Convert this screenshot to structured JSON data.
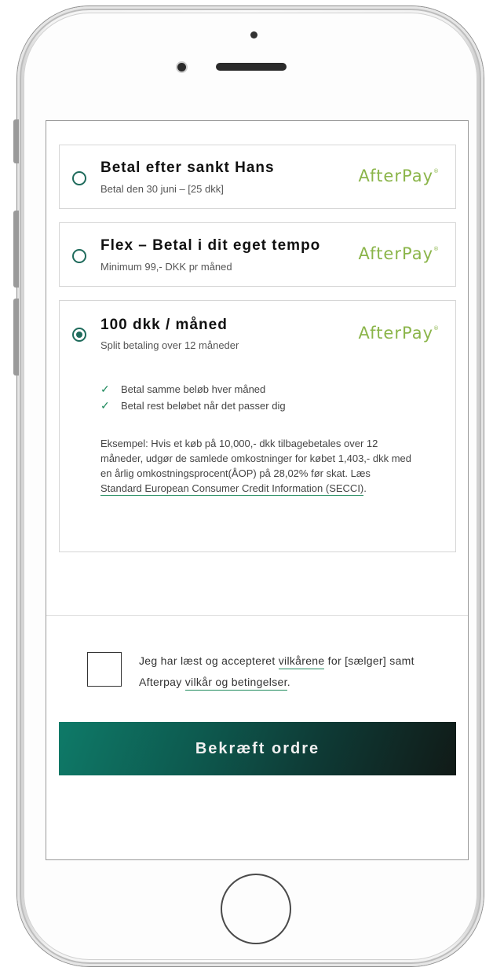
{
  "payment_options": [
    {
      "title": "Betal efter sankt Hans",
      "subtitle": "Betal den 30 juni – [25 dkk]",
      "logo": "AfterPay",
      "selected": false
    },
    {
      "title": "Flex – Betal i dit eget tempo",
      "subtitle": "Minimum 99,- DKK pr måned",
      "logo": "AfterPay",
      "selected": false
    },
    {
      "title": "100 dkk / måned",
      "subtitle": "Split betaling over 12 måneder",
      "logo": "AfterPay",
      "selected": true,
      "benefits": [
        "Betal samme beløb hver måned",
        "Betal rest beløbet når det passer dig"
      ],
      "example_text": "Eksempel: Hvis et køb på 10,000,- dkk tilbagebetales over 12 måneder, udgør de samlede omkostninger for købet 1,403,- dkk med en årlig omkostningsprocent(ÅOP) på 28,02% før skat. Læs ",
      "example_link": "Standard European Consumer Credit Information (SECCI)",
      "example_end": "."
    }
  ],
  "terms": {
    "text_before": "Jeg har læst og accepteret ",
    "link1": "vilkårene",
    "text_middle": " for [sælger] samt Afterpay ",
    "link2": "vilkår og betingelser",
    "text_end": ".",
    "checked": false
  },
  "confirm_button": "Bekræft ordre",
  "colors": {
    "accent": "#1f6b5c",
    "afterpay_logo": "#8bb54a",
    "button_start": "#0e7a68",
    "button_end": "#111a17"
  },
  "icons": [
    "radio-icon",
    "check-icon",
    "camera-icon",
    "home-button"
  ]
}
